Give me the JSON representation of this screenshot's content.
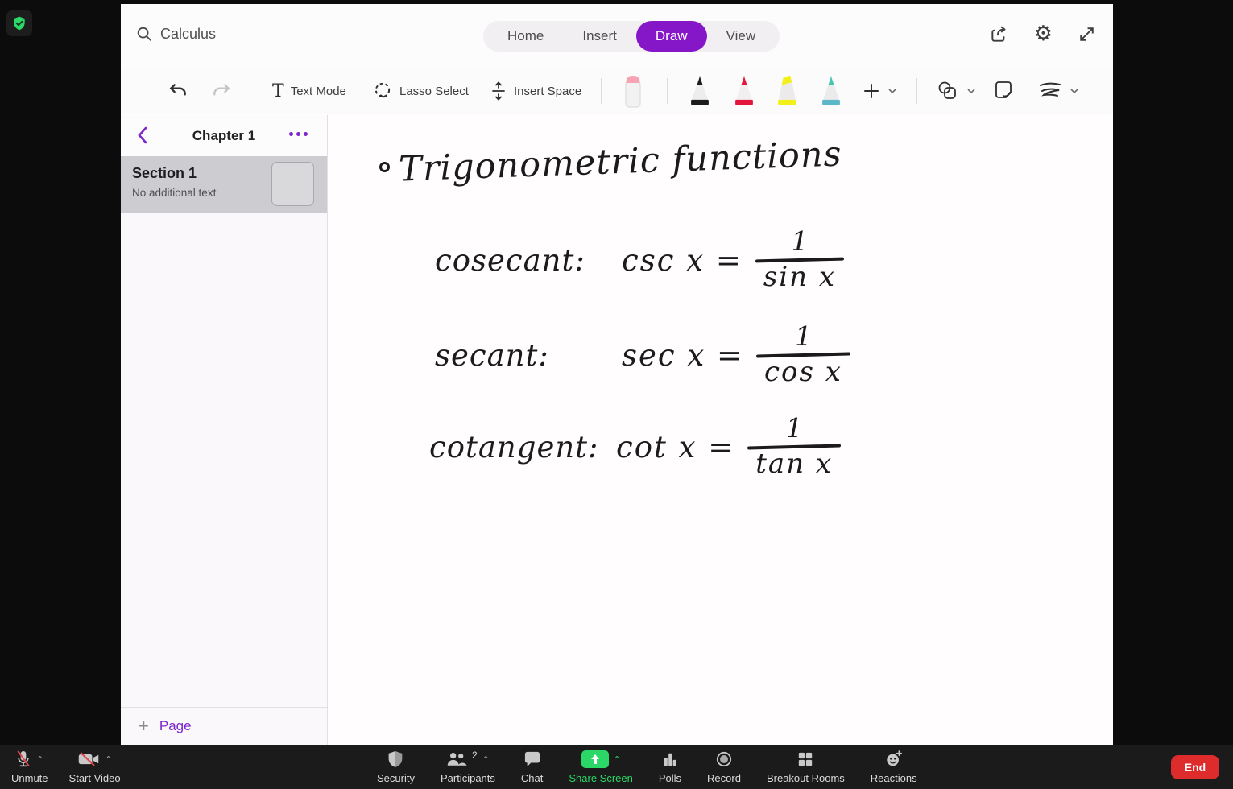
{
  "app": {
    "search": {
      "query": "Calculus"
    },
    "tabs": [
      {
        "label": "Home"
      },
      {
        "label": "Insert"
      },
      {
        "label": "Draw"
      },
      {
        "label": "View"
      }
    ],
    "toolbar": {
      "text_mode_label": "Text Mode",
      "lasso_label": "Lasso Select",
      "insert_space_label": "Insert Space"
    },
    "pens": [
      {
        "name": "black-pen",
        "color": "#1c1c1c"
      },
      {
        "name": "red-pen",
        "color": "#e3173b"
      },
      {
        "name": "yellow-highlighter",
        "color": "#f2ef1c"
      },
      {
        "name": "teal-pen",
        "color": "#49c5b1"
      }
    ],
    "accent_purple": "#8617c9"
  },
  "sidebar": {
    "title": "Chapter 1",
    "page": {
      "title": "Section 1",
      "subtitle": "No additional text"
    },
    "add_page_label": "Page"
  },
  "canvas": {
    "title": "Trigonometric functions",
    "lines": [
      {
        "label": "cosecant:",
        "lhs": "csc x =",
        "numerator": "1",
        "denominator": "sin x"
      },
      {
        "label": "secant:",
        "lhs": "sec x =",
        "numerator": "1",
        "denominator": "cos x"
      },
      {
        "label": "cotangent:",
        "lhs": "cot x =",
        "numerator": "1",
        "denominator": "tan x"
      }
    ]
  },
  "meeting": {
    "unmute_label": "Unmute",
    "start_video_label": "Start Video",
    "center": [
      {
        "label": "Security"
      },
      {
        "label": "Participants",
        "count": "2"
      },
      {
        "label": "Chat"
      },
      {
        "label": "Share Screen"
      },
      {
        "label": "Polls"
      },
      {
        "label": "Record"
      },
      {
        "label": "Breakout Rooms"
      },
      {
        "label": "Reactions"
      }
    ],
    "end_label": "End",
    "share_green": "#2bd766",
    "end_red": "#de2b2b"
  }
}
